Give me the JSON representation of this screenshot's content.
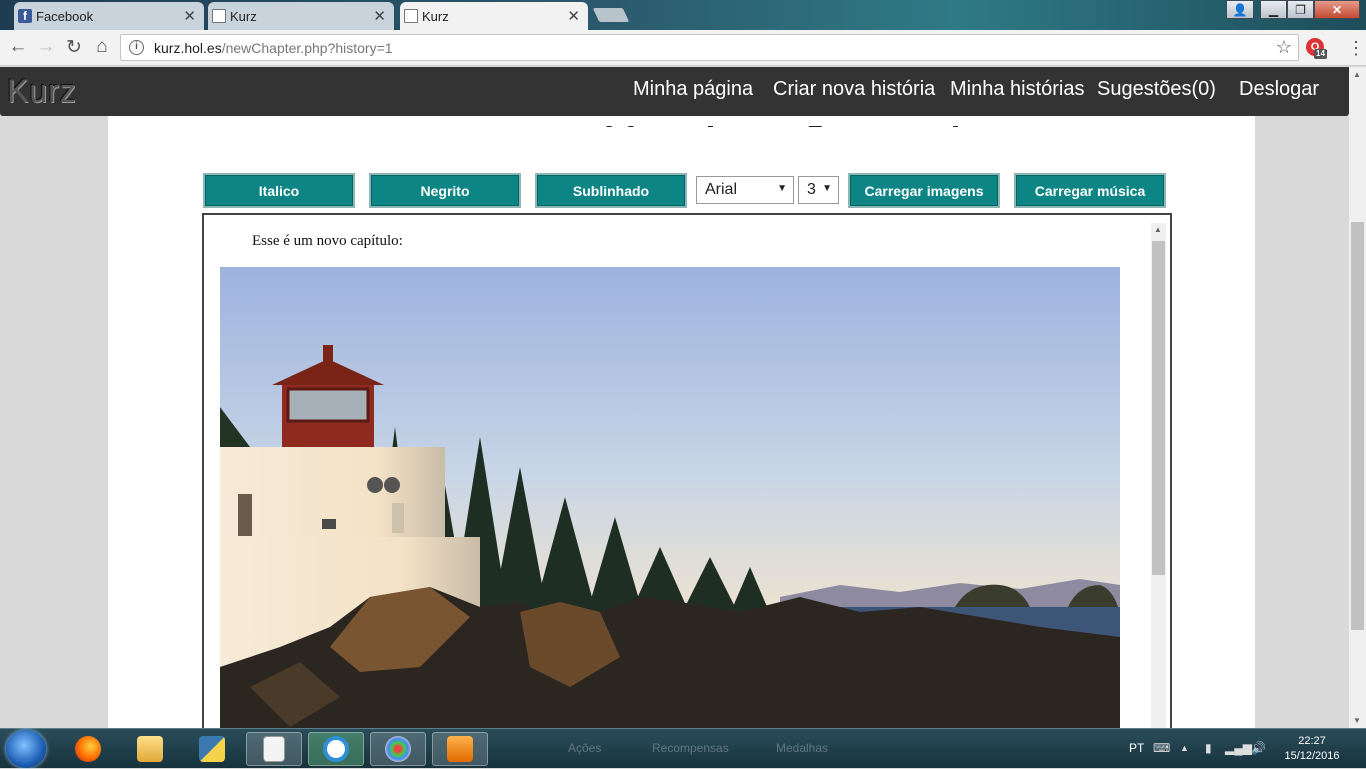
{
  "browser": {
    "tabs": [
      {
        "title": "Facebook",
        "favicon": "facebook-icon",
        "active": false
      },
      {
        "title": "Kurz",
        "favicon": "page-icon",
        "active": false
      },
      {
        "title": "Kurz",
        "favicon": "page-icon",
        "active": true
      }
    ],
    "url_host": "kurz.hol.es",
    "url_path": "/newChapter.php?history=1",
    "extension_badge": "14"
  },
  "site": {
    "logo": "Kurz",
    "nav": [
      "Minha página",
      "Criar nova história",
      "Minha histórias",
      "Sugestões(0)",
      "Deslogar"
    ]
  },
  "editor": {
    "buttons": [
      "Italico",
      "Negrito",
      "Sublinhado"
    ],
    "font_select": "Arial",
    "size_select": "3",
    "upload_buttons": [
      "Carregar imagens",
      "Carregar música"
    ],
    "text": "Esse é um novo capítulo:",
    "accent_color": "#0d8585"
  },
  "taskbar": {
    "ghost_labels": [
      "Ações",
      "Recompensas",
      "Medalhas"
    ],
    "language": "PT",
    "time": "22:27",
    "date": "15/12/2016"
  }
}
